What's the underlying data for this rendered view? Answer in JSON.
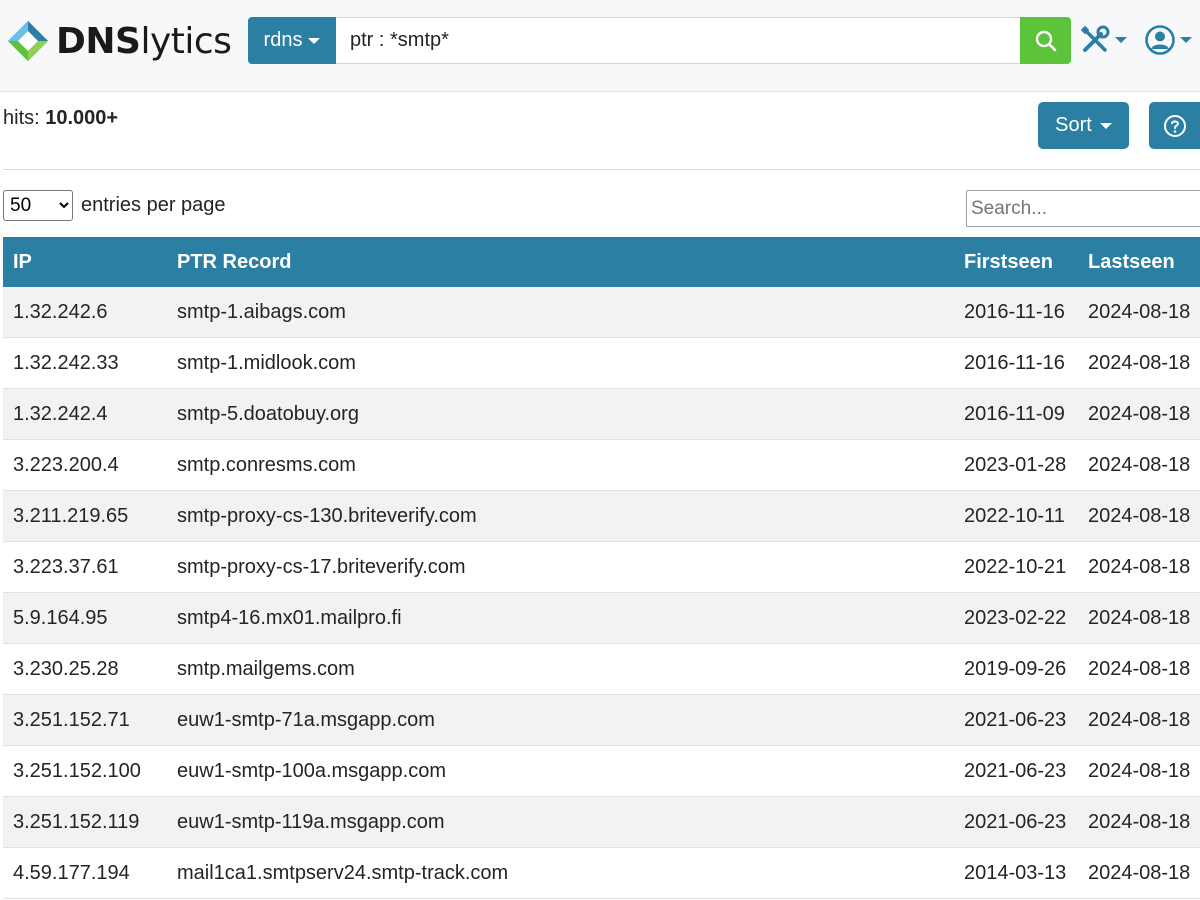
{
  "header": {
    "logo_text_bold": "DNS",
    "logo_text_rest": "lytics",
    "search_type": "rdns",
    "query": "ptr : *smtp*"
  },
  "results": {
    "hits_label": "hits:",
    "hits_value": "10.000+",
    "sort_label": "Sort"
  },
  "controls": {
    "per_page_selected": "50",
    "per_page_label": "entries per page",
    "search_placeholder": "Search..."
  },
  "table": {
    "columns": [
      "IP",
      "PTR Record",
      "Firstseen",
      "Lastseen"
    ],
    "rows": [
      [
        "1.32.242.6",
        "smtp-1.aibags.com",
        "2016-11-16",
        "2024-08-18"
      ],
      [
        "1.32.242.33",
        "smtp-1.midlook.com",
        "2016-11-16",
        "2024-08-18"
      ],
      [
        "1.32.242.4",
        "smtp-5.doatobuy.org",
        "2016-11-09",
        "2024-08-18"
      ],
      [
        "3.223.200.4",
        "smtp.conresms.com",
        "2023-01-28",
        "2024-08-18"
      ],
      [
        "3.211.219.65",
        "smtp-proxy-cs-130.briteverify.com",
        "2022-10-11",
        "2024-08-18"
      ],
      [
        "3.223.37.61",
        "smtp-proxy-cs-17.briteverify.com",
        "2022-10-21",
        "2024-08-18"
      ],
      [
        "5.9.164.95",
        "smtp4-16.mx01.mailpro.fi",
        "2023-02-22",
        "2024-08-18"
      ],
      [
        "3.230.25.28",
        "smtp.mailgems.com",
        "2019-09-26",
        "2024-08-18"
      ],
      [
        "3.251.152.71",
        "euw1-smtp-71a.msgapp.com",
        "2021-06-23",
        "2024-08-18"
      ],
      [
        "3.251.152.100",
        "euw1-smtp-100a.msgapp.com",
        "2021-06-23",
        "2024-08-18"
      ],
      [
        "3.251.152.119",
        "euw1-smtp-119a.msgapp.com",
        "2021-06-23",
        "2024-08-18"
      ],
      [
        "4.59.177.194",
        "mail1ca1.smtpserv24.smtp-track.com",
        "2014-03-13",
        "2024-08-18"
      ]
    ]
  },
  "colors": {
    "primary": "#2a7fa3",
    "search_go": "#5cc43b",
    "row_stripe": "#f2f2f2"
  },
  "icons": {
    "logo": "dnslytics-logo-icon",
    "search": "search-icon",
    "tools": "tools-icon",
    "user": "user-icon",
    "help": "question-circle-icon",
    "caret": "caret-down-icon"
  }
}
